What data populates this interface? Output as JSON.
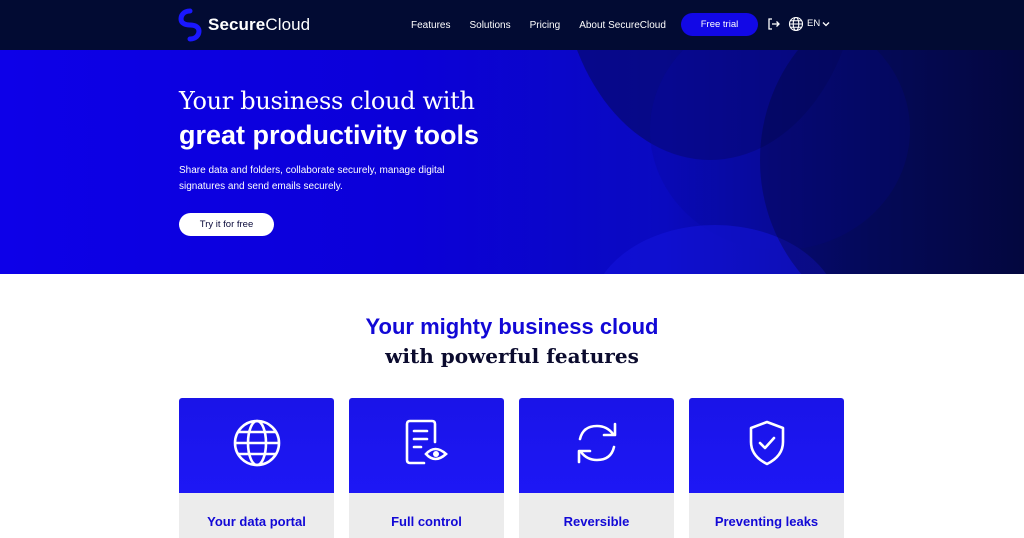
{
  "brand": {
    "name_part1": "Secure",
    "name_part2": "Cloud"
  },
  "nav": {
    "links": [
      "Features",
      "Solutions",
      "Pricing",
      "About SecureCloud"
    ],
    "cta_label": "Free trial",
    "language": "EN",
    "icons": [
      "login-icon",
      "globe-icon",
      "chevron-down-icon"
    ]
  },
  "hero": {
    "title_line1": "Your business cloud with",
    "title_line2": "great productivity tools",
    "subtitle": "Share data and folders, collaborate securely, manage digital signatures and send emails securely.",
    "button_label": "Try it for free"
  },
  "features": {
    "title_line1": "Your mighty business cloud",
    "title_line2": "with powerful features",
    "cards": [
      {
        "label": "Your data portal",
        "icon": "globe-icon"
      },
      {
        "label": "Full control",
        "icon": "document-eye-icon"
      },
      {
        "label": "Reversible",
        "icon": "refresh-icon"
      },
      {
        "label": "Preventing leaks",
        "icon": "shield-check-icon"
      }
    ]
  },
  "colors": {
    "nav_bg": "#020b33",
    "accent": "#1208e6",
    "hero_start": "#0d00e8",
    "hero_end": "#040847",
    "card_bottom": "#ececec"
  }
}
